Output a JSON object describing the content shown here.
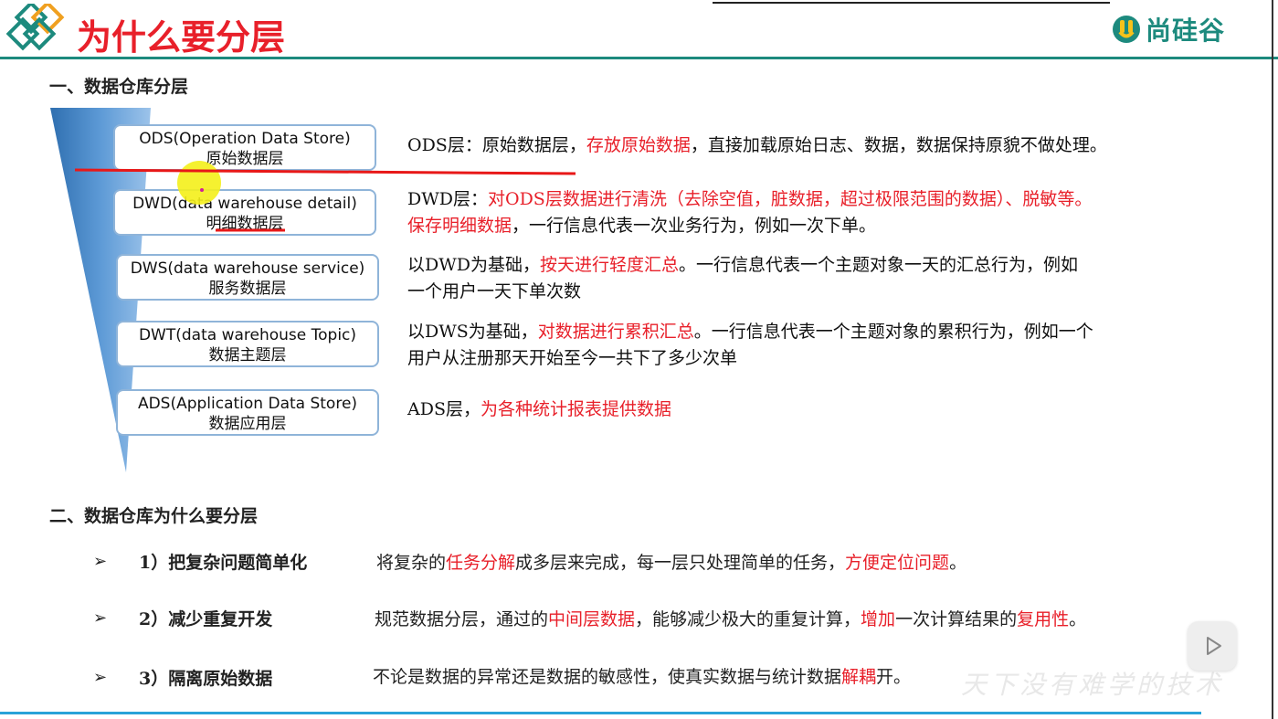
{
  "header": {
    "title": "为什么要分层",
    "brand": "尚硅谷"
  },
  "section1": {
    "heading": "一、数据仓库分层"
  },
  "layers": [
    {
      "name": "ODS(Operation Data Store)",
      "cn": "原始数据层"
    },
    {
      "name": "DWD(data warehouse detail)",
      "cn": "明细数据层"
    },
    {
      "name": "DWS(data warehouse service)",
      "cn": "服务数据层"
    },
    {
      "name": "DWT(data warehouse Topic)",
      "cn": "数据主题层"
    },
    {
      "name": "ADS(Application Data Store)",
      "cn": "数据应用层"
    }
  ],
  "descriptions": {
    "ods": {
      "a": "ODS层：原始数据层，",
      "b": "存放原始数据",
      "c": "，直接加载原始日志、数据，数据保持原貌不做处理。"
    },
    "dwd": {
      "a": "DWD层：",
      "b": "对ODS层数据进行清洗（去除空值，脏数据，超过极限范围的数据）、脱敏等。",
      "c": "保存明细数据",
      "d": "，一行信息代表一次业务行为，例如一次下单。"
    },
    "dws": {
      "a": "以DWD为基础，",
      "b": "按天进行轻度汇总",
      "c": "。一行信息代表一个主题对象一天的汇总行为，例如",
      "d": "一个用户一天下单次数"
    },
    "dwt": {
      "a": "以DWS为基础，",
      "b": "对数据进行累积汇总",
      "c": "。一行信息代表一个主题对象的累积行为，例如一个",
      "d": "用户从注册那天开始至今一共下了多少次单"
    },
    "ads": {
      "a": "ADS层，",
      "b": "为各种统计报表提供数据"
    }
  },
  "section2": {
    "heading": "二、数据仓库为什么要分层"
  },
  "reasons": [
    {
      "bullet": "➢",
      "label": "1）把复杂问题简单化",
      "t1": "将复杂的",
      "t2": "任务分解",
      "t3": "成多层来完成，每一层只处理简单的任务，",
      "t4": "方便定位问题",
      "t5": "。"
    },
    {
      "bullet": "➢",
      "label": "2）减少重复开发",
      "t1": "规范数据分层，通过的",
      "t2": "中间层数据",
      "t3": "，能够减少极大的重复计算，",
      "t4": "增加",
      "t5": "一次计算结果的",
      "t6": "复用性",
      "t7": "。"
    },
    {
      "bullet": "➢",
      "label": "3）隔离原始数据",
      "t1": "不论是数据的异常还是数据的敏感性，使真实数据与统计数据",
      "t2": "解耦",
      "t3": "开。"
    }
  ],
  "watermark": "天下没有难学的技术",
  "colors": {
    "accent_red": "#e8202a",
    "brand_teal": "#1d8a7e",
    "funnel_blue": "#3c7bb8",
    "box_border": "#8fb4d9"
  }
}
